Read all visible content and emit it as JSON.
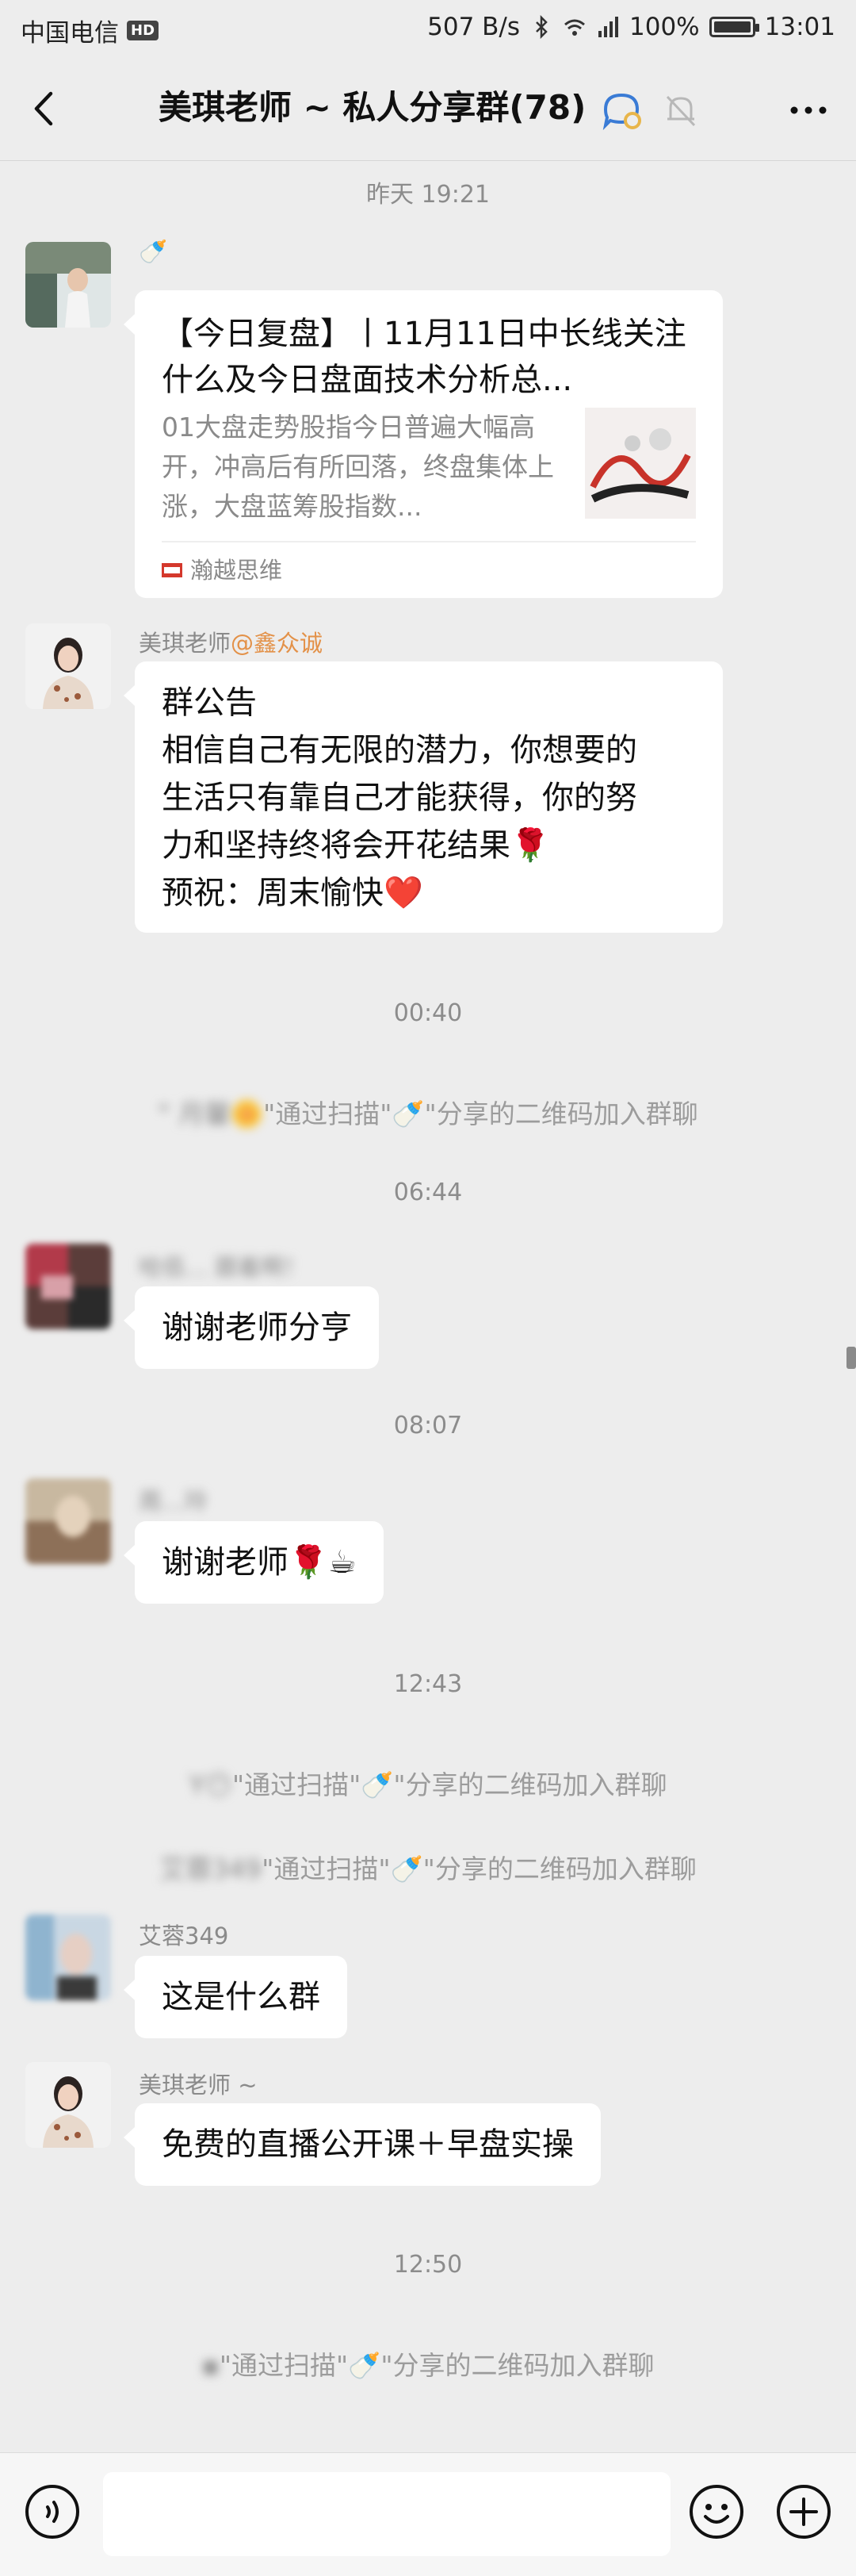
{
  "status": {
    "carrier": "中国电信",
    "hd": "HD",
    "speed": "507 B/s",
    "battery": "100%",
    "battery_level": 1.0,
    "time": "13:01"
  },
  "header": {
    "title": "美琪老师 ~ 私人分享群(78)"
  },
  "messages": {
    "t1": "昨天 19:21",
    "card": {
      "sender_icon": "baby-bottle",
      "title": "【今日复盘】丨11月11日中长线关注什么及今日盘面技术分析总...",
      "desc": "01大盘走势股指今日普遍大幅高开，冲高后有所回落，终盘集体上涨，大盘蓝筹股指数...",
      "source": "瀚越思维"
    },
    "m2": {
      "sender": "美琪老师",
      "mention": "@鑫众诚",
      "lines": [
        "群公告",
        "相信自己有无限的潜力，你想要的",
        "生活只有靠自己才能获得，你的努",
        "力和坚持终将会开花结果🌹",
        "预祝：周末愉快❤️"
      ]
    },
    "t2": "00:40",
    "s1": {
      "name": "\" 月馨🌼",
      "text": "\"通过扫描\"🍼\"分享的二维码加入群聊"
    },
    "t3": "06:44",
    "m3": {
      "sender": "哈佰… 跟着啊！",
      "text": "谢谢老师分亨"
    },
    "t4": "08:07",
    "m4": {
      "sender": "周…玲",
      "text": "谢谢老师🌹☕"
    },
    "t5": "12:43",
    "s2": {
      "name": "Y😶",
      "text": "\"通过扫描\"🍼\"分享的二维码加入群聊"
    },
    "s3": {
      "name": "艾蓉349",
      "text": "\"通过扫描\"🍼\"分享的二维码加入群聊"
    },
    "m5": {
      "sender": "艾蓉349",
      "text": "这是什么群"
    },
    "m6": {
      "sender": "美琪老师 ~",
      "text": "免费的直播公开课＋早盘实操"
    },
    "t6": "12:50",
    "s4": {
      "name": "▪",
      "text": "\"通过扫描\"🍼\"分享的二维码加入群聊"
    }
  },
  "colors": {
    "background": "#ededed",
    "bubble": "#ffffff",
    "mention": "#e39148",
    "system_text": "#9c9c9c"
  }
}
